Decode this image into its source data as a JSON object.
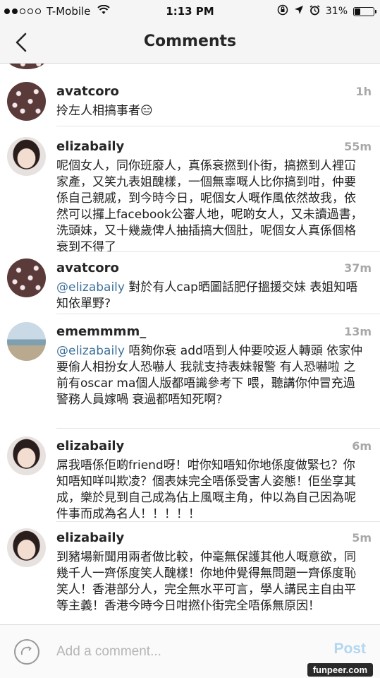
{
  "status_bar": {
    "carrier": "T-Mobile",
    "time": "1:13 PM",
    "battery": "31%",
    "battery_level": 0.31,
    "signal_bars_filled": 2,
    "icons": [
      "wifi-icon",
      "orientation-lock-icon",
      "location-icon",
      "alarm-icon",
      "battery-icon"
    ]
  },
  "nav": {
    "title": "Comments",
    "back_icon": "chevron-left-icon"
  },
  "comments": [
    {
      "username": "avatcoro",
      "time": "1h",
      "avatar": "flower-avatar",
      "mention": "",
      "text": "拎左人相搞事者😑"
    },
    {
      "username": "elizabaily",
      "time": "55m",
      "avatar": "girl-avatar",
      "mention": "",
      "text": "呢個女人，同你班廢人，真係衰撚到仆街，搞撚到人裡冚家產，又笑九表姐醜樣，一個無辜嘅人比你搞到咁，仲要係自己親戚，到今時今日，呢個女人嘅作風依然故我，依然可以攞上facebook公審人地，呢啲女人，又未讀過書，洗頭妹，又十幾歲俾人抽插搞大個肚，呢個女人真係個格衰到不得了"
    },
    {
      "username": "avatcoro",
      "time": "37m",
      "avatar": "flower-avatar",
      "mention": "@elizabaily",
      "text": " 對於有人cap晒圖話肥仔搵援交妹 表姐知唔知依單野?"
    },
    {
      "username": "ememmmm_",
      "time": "13m",
      "avatar": "beach-avatar",
      "mention": "@elizabaily",
      "text": " 唔夠你衰 add唔到人仲要咬返人轉頭 依家仲要偷人相扮女人恐嚇人 我就支持表妹報警 有人恐嚇啦 之前有oscar ma個人版都唔識參考下 喂，聽講你仲冒充過警務人員嫁喎 衰過都唔知死啊?"
    },
    {
      "username": "elizabaily",
      "time": "6m",
      "avatar": "girl-avatar",
      "mention": "",
      "text": "屌我唔係佢啲friend呀！咁你知唔知你地係度做緊乜？你知唔知咩叫欺凌？個表妹完全唔係受害人姿態！佢坐享其成，樂於見到自己成為佔上風嘅主角，仲以為自己因為呢件事而成為名人！！！！！"
    },
    {
      "username": "elizabaily",
      "time": "5m",
      "avatar": "girl-avatar",
      "mention": "",
      "text": "到豬場新聞用兩者做比較，仲毫無保護其他人嘅意欲，同幾千人一齊係度笑人醜樣！你地仲覺得無問題一齊係度恥笑人！香港部分人，完全無水平可言，學人講民主自由平等主義！香港今時今日咁撚仆街完全唔係無原因！"
    }
  ],
  "input": {
    "placeholder": "Add a comment...",
    "post_label": "Post",
    "camera_icon": "camera-icon"
  },
  "watermark": "funpeer.com"
}
